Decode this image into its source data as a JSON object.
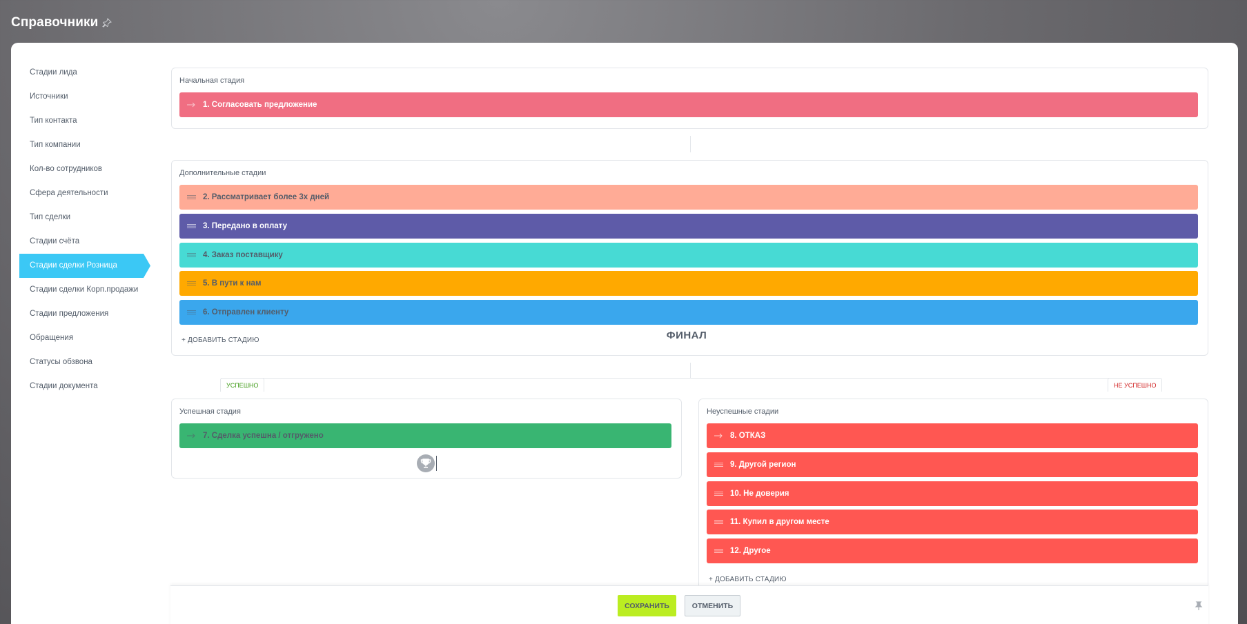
{
  "page": {
    "title": "Справочники"
  },
  "sidebar": {
    "items": [
      {
        "label": "Стадии лида"
      },
      {
        "label": "Источники"
      },
      {
        "label": "Тип контакта"
      },
      {
        "label": "Тип компании"
      },
      {
        "label": "Кол-во сотрудников"
      },
      {
        "label": "Сфера деятельности"
      },
      {
        "label": "Тип сделки"
      },
      {
        "label": "Стадии счёта"
      },
      {
        "label": "Стадии сделки Розница",
        "active": true
      },
      {
        "label": "Стадии сделки Корп.продажи"
      },
      {
        "label": "Стадии предложения"
      },
      {
        "label": "Обращения"
      },
      {
        "label": "Статусы обзвона"
      },
      {
        "label": "Стадии документа"
      }
    ]
  },
  "initial": {
    "title": "Начальная стадия",
    "stage": {
      "label": "1. Согласовать предложение",
      "color": "#f06e82",
      "text_color": "#ffffff"
    }
  },
  "additional": {
    "title": "Дополнительные стадии",
    "stages": [
      {
        "label": "2. Рассматривает более 3х дней",
        "color": "#ffab96",
        "text_color": "#535c69"
      },
      {
        "label": "3. Передано в оплату",
        "color": "#5e5ba8",
        "text_color": "#ffffff"
      },
      {
        "label": "4. Заказ поставщику",
        "color": "#47dad4",
        "text_color": "#535c69"
      },
      {
        "label": "5. В пути к нам",
        "color": "#ffa900",
        "text_color": "#535c69"
      },
      {
        "label": "6. Отправлен клиенту",
        "color": "#3aa7ed",
        "text_color": "#535c69"
      }
    ],
    "add_label": "+ ДОБАВИТЬ СТАДИЮ"
  },
  "final": {
    "title": "ФИНАЛ",
    "success_tab": "УСПЕШНО",
    "fail_tab": "НЕ УСПЕШНО",
    "success": {
      "title": "Успешная стадия",
      "stage": {
        "label": "7. Сделка успешна / отгружено",
        "color": "#39b572",
        "text_color": "#535c69"
      }
    },
    "fail": {
      "title": "Неуспешные стадии",
      "stages": [
        {
          "label": "8. ОТКАЗ",
          "color": "#ff5752",
          "text_color": "#ffffff"
        },
        {
          "label": "9. Другой регион",
          "color": "#ff5752",
          "text_color": "#ffffff"
        },
        {
          "label": "10. Не доверия",
          "color": "#ff5752",
          "text_color": "#ffffff"
        },
        {
          "label": "11. Купил в другом месте",
          "color": "#ff5752",
          "text_color": "#ffffff"
        },
        {
          "label": "12. Другое",
          "color": "#ff5752",
          "text_color": "#ffffff"
        }
      ],
      "add_label": "+ ДОБАВИТЬ СТАДИЮ"
    }
  },
  "footer": {
    "save_label": "СОХРАНИТЬ",
    "cancel_label": "ОТМЕНИТЬ"
  },
  "colors": {
    "success_text": "#3f9b17",
    "fail_text": "#d01e1e",
    "accent": "#3bc8f5"
  }
}
